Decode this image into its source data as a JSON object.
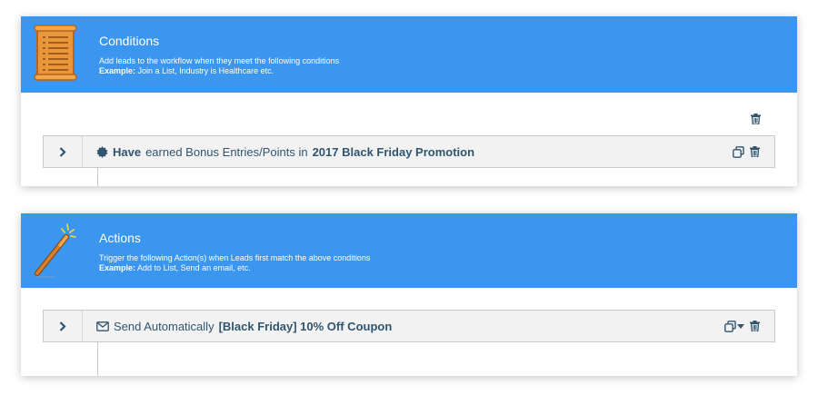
{
  "conditions": {
    "title": "Conditions",
    "description": "Add leads to the workflow when they meet the following conditions",
    "example_label": "Example:",
    "example_text": "Join a List, Industry is Healthcare etc.",
    "icon": "scroll-list-icon",
    "rows": [
      {
        "prefix": "Have",
        "middle": "earned Bonus Entries/Points in",
        "target": "2017 Black Friday Promotion",
        "icon": "badge-icon"
      }
    ]
  },
  "actions": {
    "title": "Actions",
    "description": "Trigger the following Action(s) when Leads first match the above conditions",
    "example_label": "Example:",
    "example_text": "Add to List, Send an email, etc.",
    "icon": "magic-wand-icon",
    "rows": [
      {
        "prefix": "Send Automatically",
        "target": "[Black Friday] 10% Off Coupon",
        "icon": "envelope-icon"
      }
    ]
  },
  "colors": {
    "header_blue": "#3a96ee",
    "text_dark": "#30556f",
    "row_bg": "#f2f2f2"
  }
}
